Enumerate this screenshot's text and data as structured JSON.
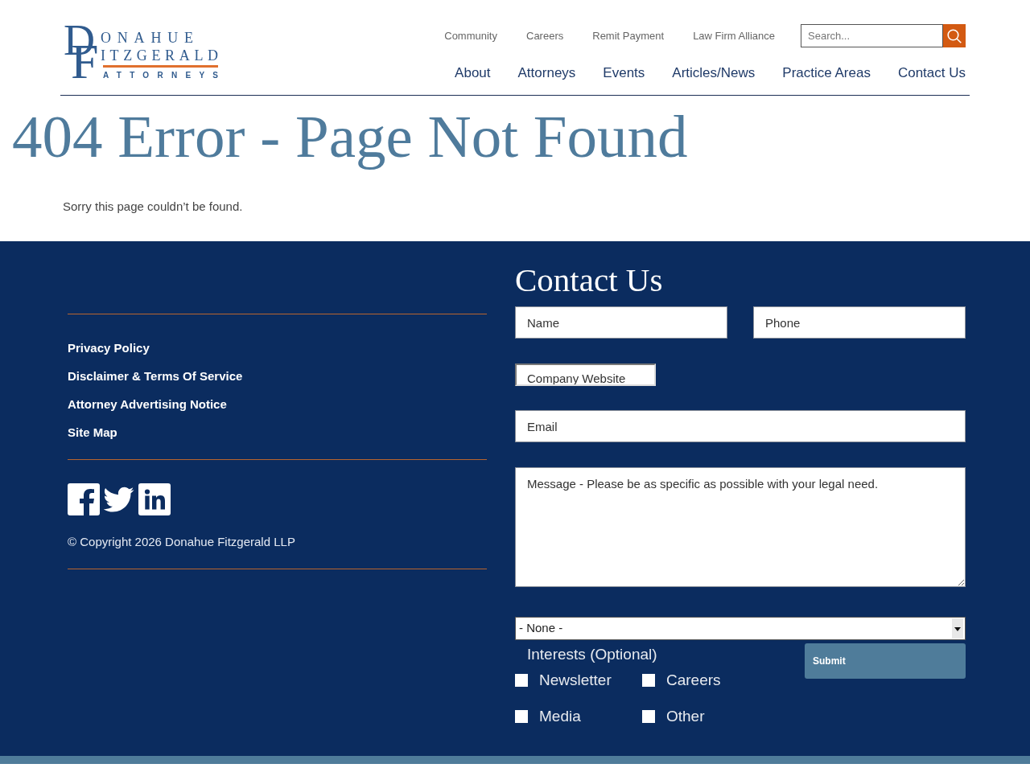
{
  "header": {
    "logo": {
      "initial_1": "D",
      "line_1": "ONAHUE",
      "initial_2": "F",
      "line_2": "ITZGERALD",
      "tagline": "ATTORNEYS"
    },
    "utility_nav": [
      "Community",
      "Careers",
      "Remit Payment",
      "Law Firm Alliance"
    ],
    "search": {
      "placeholder": "Search..."
    },
    "main_nav": [
      "About",
      "Attorneys",
      "Events",
      "Articles/News",
      "Practice Areas",
      "Contact Us"
    ]
  },
  "page": {
    "title": "404 Error - Page Not Found",
    "message": "Sorry this page couldn’t be found."
  },
  "footer": {
    "links": [
      "Privacy Policy",
      "Disclaimer & Terms Of Service",
      "Attorney Advertising Notice",
      "Site Map"
    ],
    "copyright": "© Copyright 2026 Donahue Fitzgerald LLP"
  },
  "contact_form": {
    "title": "Contact Us",
    "name_field": {
      "placeholder": "Name"
    },
    "phone_field": {
      "placeholder": "Phone"
    },
    "company_website_field": {
      "placeholder": "Company Website"
    },
    "email_field": {
      "placeholder": "Email"
    },
    "message_field": {
      "placeholder": "Message - Please be as specific as possible with your legal need."
    },
    "dropdown": {
      "value": "- None -"
    },
    "interests": {
      "label": "Interests (Optional)",
      "options": [
        {
          "label": "Newsletter",
          "checked": false
        },
        {
          "label": "Careers",
          "checked": false
        },
        {
          "label": "Media",
          "checked": false
        },
        {
          "label": "Other",
          "checked": false
        }
      ]
    },
    "submit": "Submit"
  }
}
